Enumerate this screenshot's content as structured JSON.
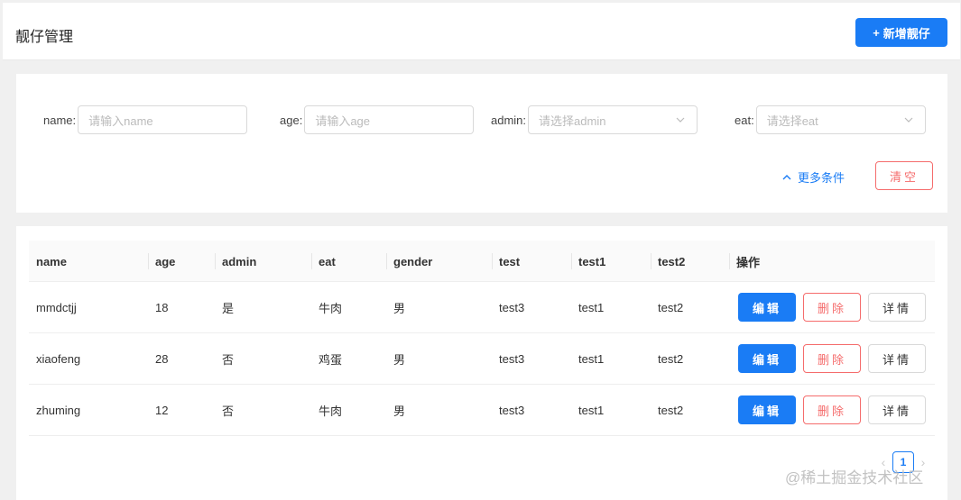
{
  "header": {
    "title": "靓仔管理",
    "add_button": "新增靓仔"
  },
  "search": {
    "fields": [
      {
        "label": "name:",
        "placeholder": "请输入name"
      },
      {
        "label": "age:",
        "placeholder": "请输入age"
      },
      {
        "label": "admin:",
        "placeholder": "请选择admin"
      },
      {
        "label": "eat:",
        "placeholder": "请选择eat"
      }
    ],
    "more_label": "更多条件",
    "clear_label": "清空"
  },
  "table": {
    "columns": [
      "name",
      "age",
      "admin",
      "eat",
      "gender",
      "test",
      "test1",
      "test2",
      "操作"
    ],
    "rows": [
      {
        "name": "mmdctjj",
        "age": "18",
        "admin": "是",
        "eat": "牛肉",
        "gender": "男",
        "test": "test3",
        "test1": "test1",
        "test2": "test2"
      },
      {
        "name": "xiaofeng",
        "age": "28",
        "admin": "否",
        "eat": "鸡蛋",
        "gender": "男",
        "test": "test3",
        "test1": "test1",
        "test2": "test2"
      },
      {
        "name": "zhuming",
        "age": "12",
        "admin": "否",
        "eat": "牛肉",
        "gender": "男",
        "test": "test3",
        "test1": "test1",
        "test2": "test2"
      }
    ],
    "actions": {
      "edit": "编辑",
      "delete": "删除",
      "detail": "详情"
    }
  },
  "pagination": {
    "current": "1",
    "prev_icon": "chevron-left-icon",
    "next_icon": "chevron-right-icon"
  },
  "watermark": "@稀土掘金技术社区",
  "colors": {
    "primary": "#1a7cf5",
    "danger": "#f56c6c"
  }
}
